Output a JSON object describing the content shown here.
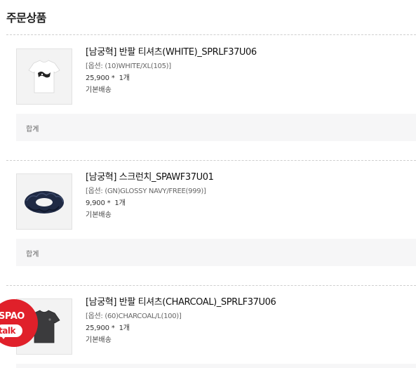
{
  "section": {
    "title": "주문상품"
  },
  "items": [
    {
      "name": "[남궁혁] 반팔 티셔츠(WHITE)_SPRLF37U06",
      "option": "[옵션: (10)WHITE/XL(105)]",
      "price": "25,900 *",
      "qty": "1개",
      "shipping": "기본배송",
      "total_label": "합계",
      "thumb_icon": "white-tshirt-icon"
    },
    {
      "name": "[남궁혁] 스크런치_SPAWF37U01",
      "option": "[옵션: (GN)GLOSSY NAVY/FREE(999)]",
      "price": "9,900 *",
      "qty": "1개",
      "shipping": "기본배송",
      "total_label": "합계",
      "thumb_icon": "navy-scrunchie-icon"
    },
    {
      "name": "[남궁혁] 반팔 티셔츠(CHARCOAL)_SPRLF37U06",
      "option": "[옵션: (60)CHARCOAL/L(100)]",
      "price": "25,900 *",
      "qty": "1개",
      "shipping": "기본배송",
      "thumb_icon": "charcoal-tshirt-icon"
    }
  ],
  "talk_badge": {
    "brand": "SPAO",
    "label": "talk"
  },
  "colors": {
    "accent": "#e0202a",
    "total_bg": "#f6f6f7",
    "divider": "#cfcfcf"
  }
}
